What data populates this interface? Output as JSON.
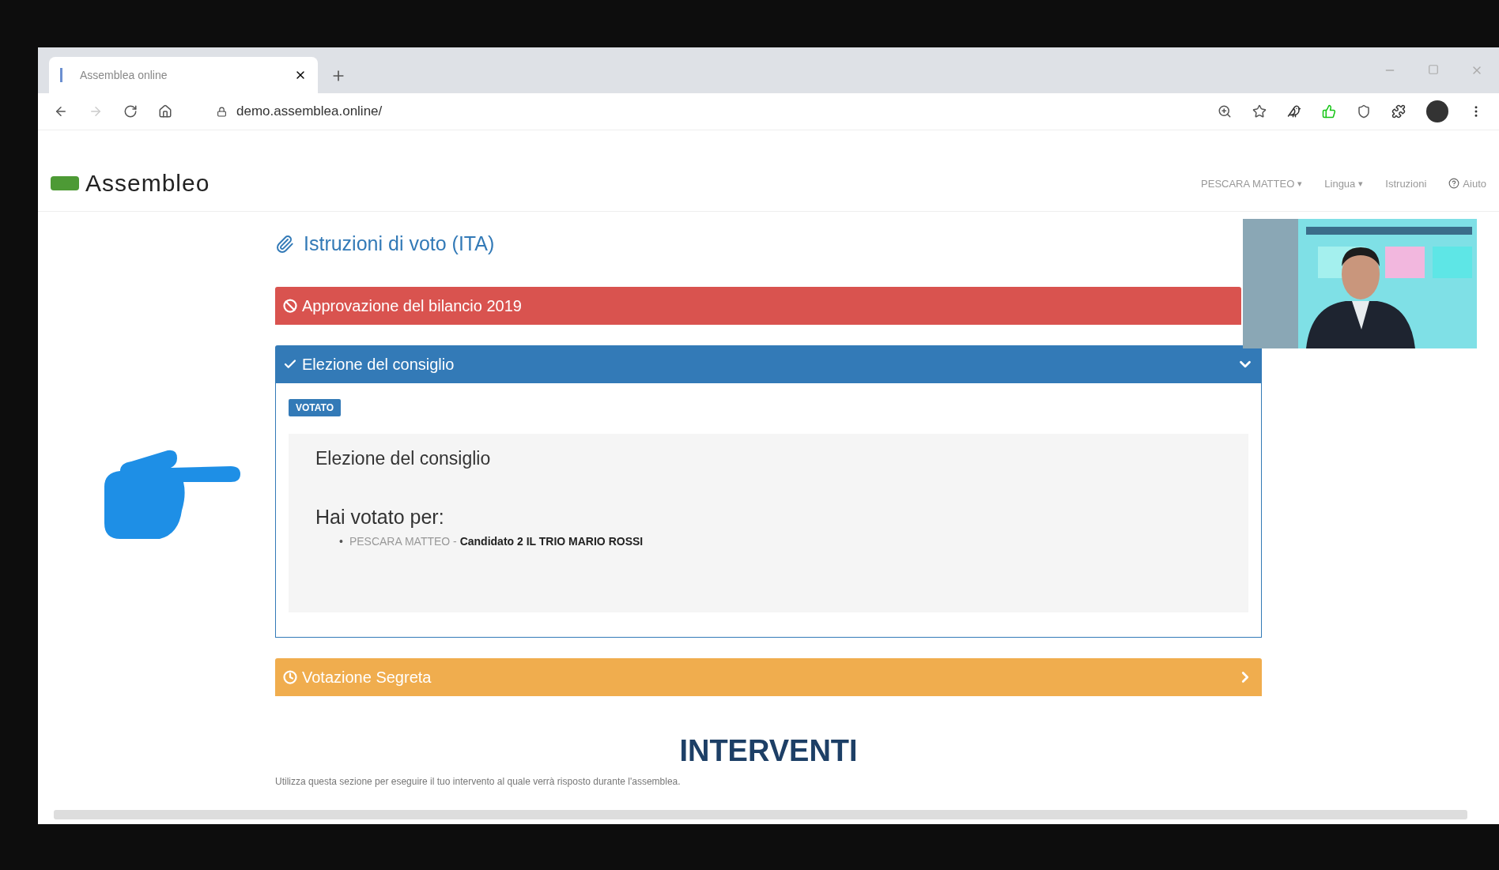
{
  "browser": {
    "tab_title": "Assemblea online",
    "url": "demo.assemblea.online/"
  },
  "header": {
    "logo": "Assembleo",
    "nav": [
      {
        "label": "PESCARA MATTEO",
        "caret": "▾",
        "kind": "menu"
      },
      {
        "label": "Lingua",
        "caret": "▾",
        "kind": "menu"
      },
      {
        "label": "Istruzioni",
        "kind": "menu"
      },
      {
        "label": "Aiuto",
        "kind": "help"
      }
    ]
  },
  "instructions_link": "Istruzioni di voto (ITA)",
  "votes": [
    {
      "title": "Approvazione del bilancio 2019",
      "kind": "closed"
    },
    {
      "title": "Elezione del consiglio",
      "kind": "voted",
      "expanded": true,
      "badge": "VOTATO",
      "body_title": "Elezione del consiglio",
      "voted_for_label": "Hai votato per:",
      "choices": [
        {
          "bullet": "•",
          "text": "PESCARA MATTEO - **Candidato 2 IL TRIO MARIO ROSSI**"
        }
      ]
    },
    {
      "title": "Votazione Segreta",
      "kind": "open",
      "expanded": false
    }
  ],
  "interventi": {
    "title": "INTERVENTI",
    "description": "Utilizza questa sezione per eseguire il tuo intervento al quale verrà risposto durante l'assemblea."
  }
}
